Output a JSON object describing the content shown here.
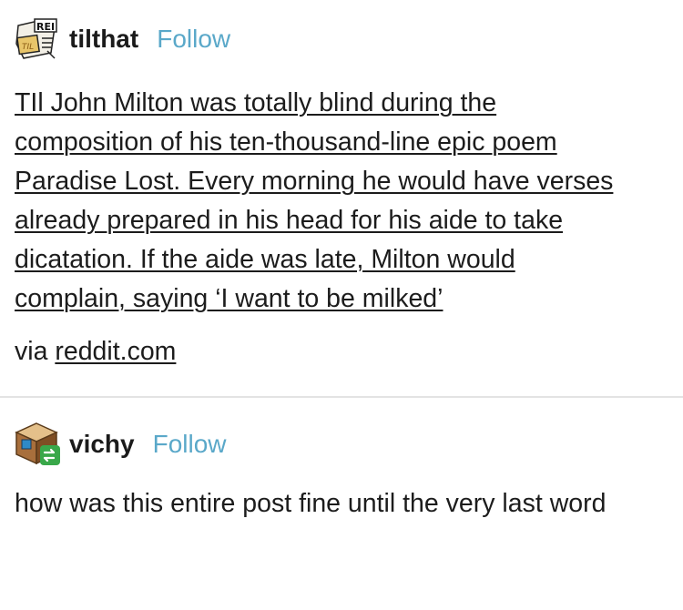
{
  "post1": {
    "avatar_icon": "til-newspaper-avatar-icon",
    "avatar_text": "REI",
    "username": "tilthat",
    "follow_label": "Follow",
    "body_lines": [
      "TIl John Milton was totally blind during the",
      "composition of his ten-thousand-line epic poem",
      "Paradise Lost. Every morning he would have verses",
      "already prepared in his head for his aide to take",
      "dicatation. If the aide was late, Milton would",
      "complain, saying ‘I want to be milked’"
    ],
    "via_prefix": "via",
    "via_link": "reddit.com"
  },
  "post2": {
    "avatar_icon": "cube-reblog-avatar-icon",
    "username": "vichy",
    "follow_label": "Follow",
    "reply_text": "how was this entire post fine until the very last word"
  },
  "colors": {
    "follow": "#5aa8c9",
    "divider": "#e3e3e3",
    "reblog_badge": "#39a84a"
  }
}
